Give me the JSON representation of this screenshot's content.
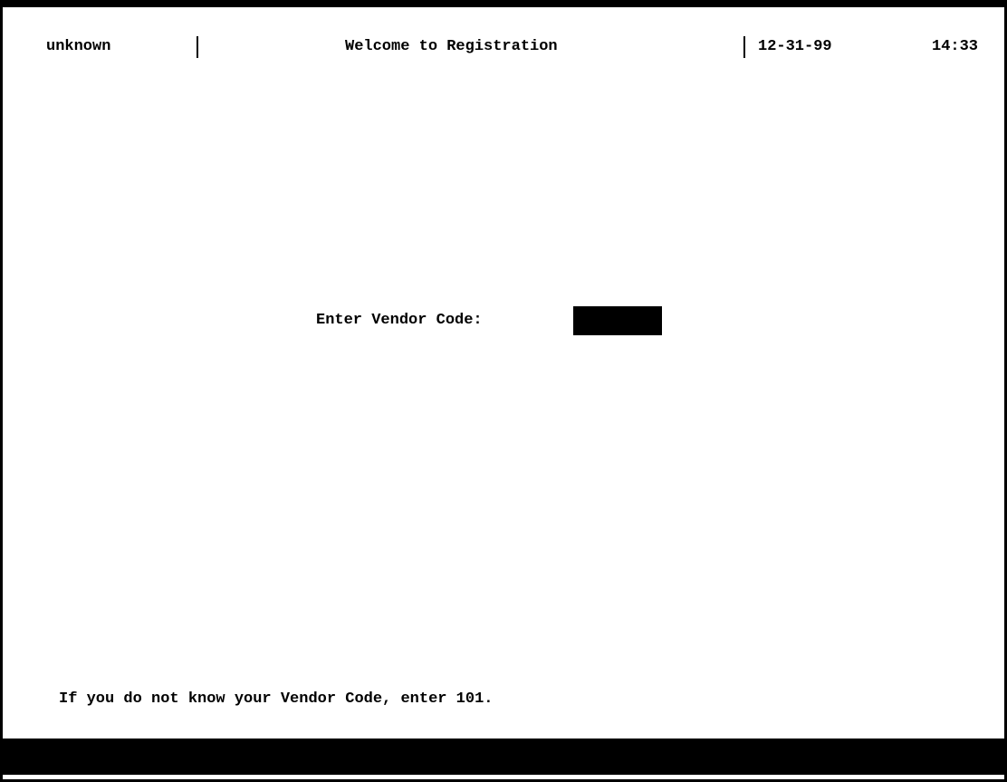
{
  "header": {
    "user": "unknown",
    "title": "Welcome to Registration",
    "date": "12-31-99",
    "time": "14:33"
  },
  "form": {
    "vendor_code_label": "Enter Vendor Code:",
    "vendor_code_value": ""
  },
  "hint": {
    "text": "If you do not know your Vendor Code, enter 101."
  },
  "colors": {
    "background": "#ffffff",
    "foreground": "#000000",
    "input_background": "#000000"
  }
}
